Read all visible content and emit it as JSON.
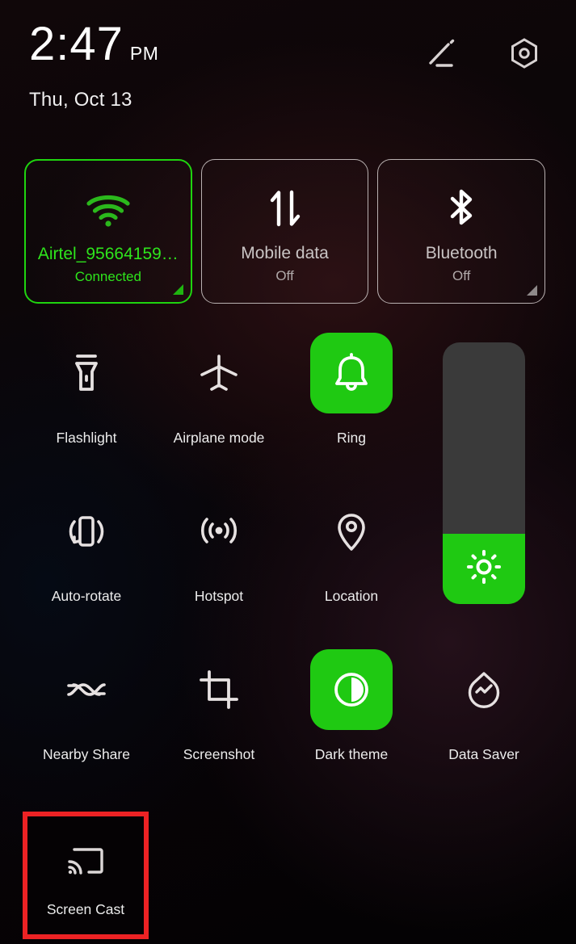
{
  "status_bar": {
    "time": "2:47",
    "am_pm": "PM",
    "date": "Thu, Oct 13",
    "actions": [
      {
        "name": "edit-icon",
        "label": "Edit"
      },
      {
        "name": "settings-icon",
        "label": "Settings"
      }
    ]
  },
  "colors": {
    "accent_green": "#1fc912",
    "active_text_green": "#2ee51c",
    "highlight_red": "#ed2224",
    "label_white": "#ececec",
    "tile_border": "#b9b1b1",
    "slider_track": "#3a3a3a",
    "background": "#060305"
  },
  "connectivity_tiles": [
    {
      "label": "Airtel_95664159…",
      "sub": "Connected",
      "icon": "wifi-icon",
      "active": true,
      "has_expand_arrow": true
    },
    {
      "label": "Mobile data",
      "sub": "Off",
      "icon": "mobile-data-icon",
      "active": false,
      "has_expand_arrow": false
    },
    {
      "label": "Bluetooth",
      "sub": "Off",
      "icon": "bluetooth-icon",
      "active": false,
      "has_expand_arrow": true
    }
  ],
  "toggles": [
    {
      "label": "Flashlight",
      "icon": "flashlight-icon",
      "active": false
    },
    {
      "label": "Airplane mode",
      "icon": "airplane-icon",
      "active": false
    },
    {
      "label": "Ring",
      "icon": "bell-icon",
      "active": true
    },
    {
      "label": "Auto-rotate",
      "icon": "auto-rotate-icon",
      "active": false
    },
    {
      "label": "Hotspot",
      "icon": "hotspot-icon",
      "active": false
    },
    {
      "label": "Location",
      "icon": "location-pin-icon",
      "active": false
    },
    {
      "label": "Nearby Share",
      "icon": "nearby-share-icon",
      "active": false
    },
    {
      "label": "Screenshot",
      "icon": "screenshot-icon",
      "active": false
    },
    {
      "label": "Dark theme",
      "icon": "dark-theme-icon",
      "active": true
    },
    {
      "label": "Data Saver",
      "icon": "data-saver-icon",
      "active": false
    }
  ],
  "brightness_slider": {
    "name": "brightness-slider",
    "icon": "brightness-sun-icon",
    "fill_percent": 27
  },
  "highlighted_tile": {
    "label": "Screen Cast",
    "icon": "screen-cast-icon",
    "highlight_color": "#ed2224"
  }
}
